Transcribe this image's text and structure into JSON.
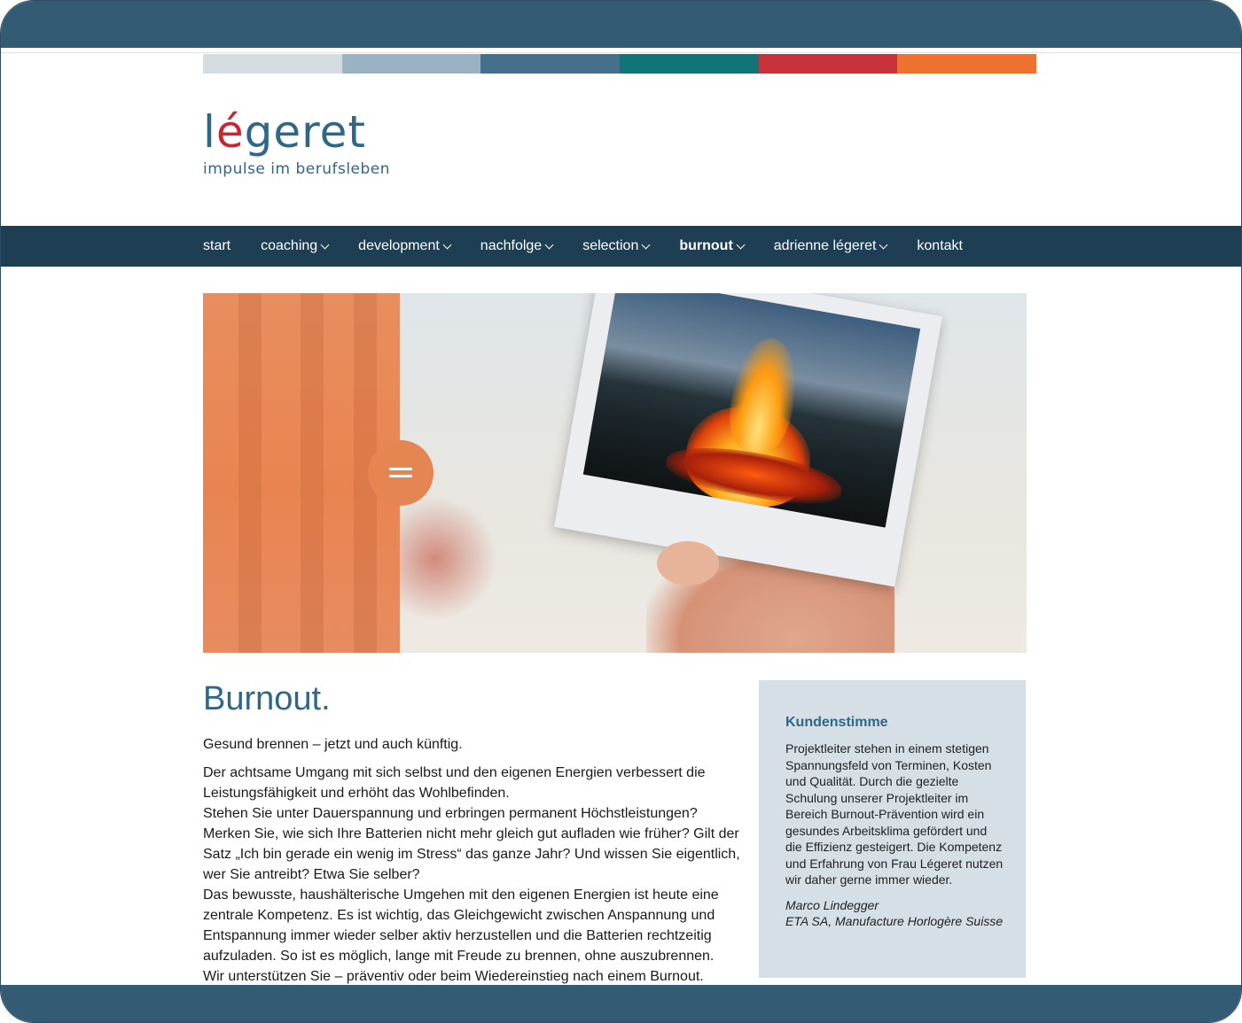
{
  "brand": {
    "logo_text_before": "l",
    "logo_text_accent": "é",
    "logo_text_after": "geret",
    "tagline": "impulse im berufsleben"
  },
  "colorbar": [
    "#d5dde3",
    "#9bb2c2",
    "#44708b",
    "#117479",
    "#c6313a",
    "#ee7130"
  ],
  "nav": {
    "items": [
      {
        "label": "start",
        "dropdown": false
      },
      {
        "label": "coaching",
        "dropdown": true
      },
      {
        "label": "development",
        "dropdown": true
      },
      {
        "label": "nachfolge",
        "dropdown": true
      },
      {
        "label": "selection",
        "dropdown": true
      },
      {
        "label": "burnout",
        "dropdown": true,
        "active": true
      },
      {
        "label": "adrienne légeret",
        "dropdown": true
      },
      {
        "label": "kontakt",
        "dropdown": false
      }
    ]
  },
  "hero": {
    "menu_button_icon": "equals-icon"
  },
  "main": {
    "title": "Burnout.",
    "lead": "Gesund brennen – jetzt und auch künftig.",
    "paragraphs": [
      "Der achtsame Umgang mit sich selbst und den eigenen Energien verbessert die Leistungsfähigkeit und erhöht das Wohlbefinden.",
      "Stehen Sie unter Dauerspannung und erbringen permanent Höchstleistungen? Merken Sie, wie sich Ihre Batterien nicht mehr gleich gut aufladen wie früher? Gilt der Satz „Ich bin gerade ein wenig im Stress“ das ganze Jahr? Und wissen Sie eigentlich, wer Sie antreibt? Etwa Sie selber?",
      "Das bewusste, haushälterische Umgehen mit den eigenen Energien ist heute eine zentrale Kompetenz. Es ist wichtig, das Gleichgewicht zwischen Anspannung und Entspannung immer wieder selber aktiv herzustellen und die Batterien rechtzeitig aufzuladen. So ist es möglich, lange mit Freude zu brennen, ohne auszubrennen.",
      "Wir unterstützen Sie – präventiv oder beim Wiedereinstieg nach einem Burnout."
    ]
  },
  "testimonial": {
    "heading": "Kundenstimme",
    "quote": "Projektleiter stehen in einem stetigen Spannungsfeld von Terminen, Kosten und Qualität. Durch die gezielte Schulung unserer Projektleiter im Bereich Burnout-Prävention wird ein gesundes Arbeitsklima gefördert und die Effizienz gesteigert. Die Kompetenz und Erfahrung von Frau Légeret nutzen wir daher gerne immer wieder.",
    "author": "Marco Lindegger",
    "company": "ETA SA, Manufacture Horlogère Suisse"
  },
  "colors": {
    "frame": "#335c74",
    "nav_bg": "#1e3e53",
    "accent_blue": "#2f6787",
    "accent_orange": "#e58552",
    "aside_bg": "#d6dfe5"
  }
}
